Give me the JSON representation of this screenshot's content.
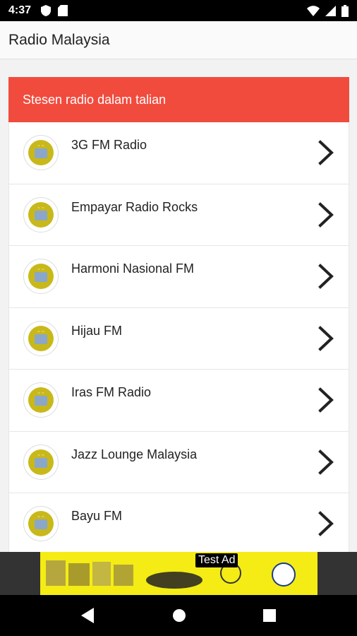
{
  "status_bar": {
    "time": "4:37",
    "left_icons": [
      "shield-icon",
      "sd-card-icon"
    ],
    "right_icons": [
      "wifi-icon",
      "signal-icon",
      "battery-icon"
    ]
  },
  "app_bar": {
    "title": "Radio Malaysia"
  },
  "section_header": {
    "title": "Stesen radio dalam talian",
    "color": "#f14b3d"
  },
  "stations": [
    {
      "name": "3G FM Radio"
    },
    {
      "name": "Empayar Radio Rocks"
    },
    {
      "name": "Harmoni Nasional FM"
    },
    {
      "name": "Hijau FM"
    },
    {
      "name": "Iras FM Radio"
    },
    {
      "name": "Jazz Lounge Malaysia"
    },
    {
      "name": "Bayu FM"
    }
  ],
  "ad": {
    "label": "Test Ad"
  },
  "nav_bar": {
    "buttons": [
      "back-icon",
      "home-icon",
      "recents-icon"
    ]
  }
}
